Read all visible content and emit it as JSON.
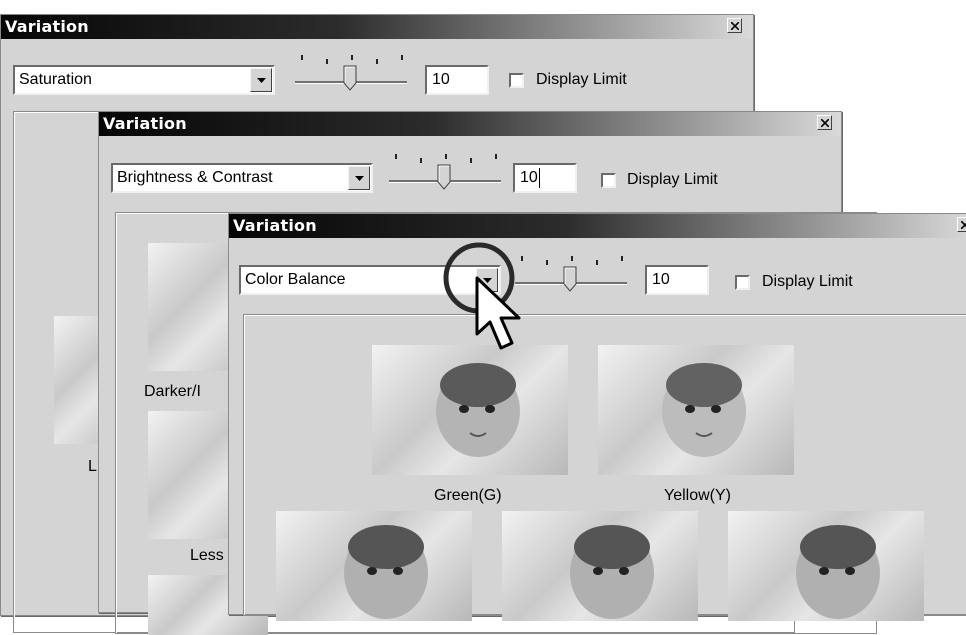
{
  "windows": [
    {
      "title": "Variation",
      "dropdown_value": "Saturation",
      "number_value": "10",
      "display_limit_label": "Display Limit",
      "captions": [
        "L"
      ]
    },
    {
      "title": "Variation",
      "dropdown_value": "Brightness & Contrast",
      "number_value": "10",
      "display_limit_label": "Display Limit",
      "captions": [
        "Darker/I",
        "Less"
      ]
    },
    {
      "title": "Variation",
      "dropdown_value": "Color Balance",
      "number_value": "10",
      "display_limit_label": "Display Limit",
      "captions": [
        "Green(G)",
        "Yellow(Y)"
      ]
    }
  ],
  "icons": {
    "close": "close-icon",
    "dropdown": "dropdown-arrow-icon",
    "cursor": "arrow-pointer-icon",
    "highlight": "highlight-circle"
  }
}
